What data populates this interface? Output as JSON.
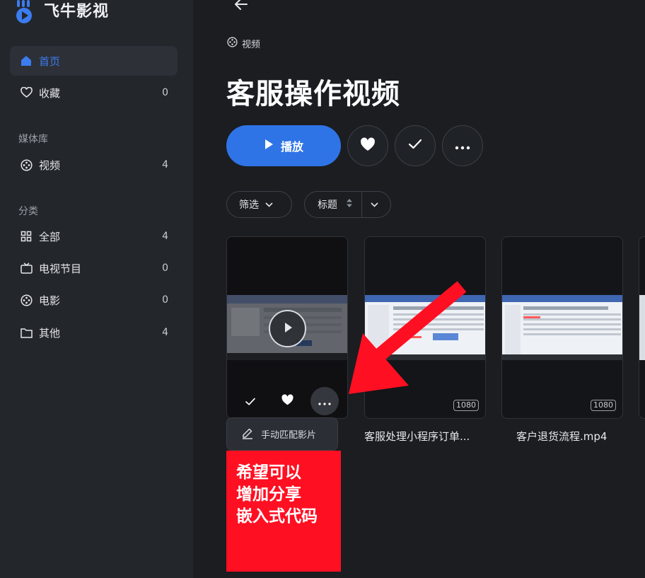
{
  "app": {
    "name": "飞牛影视"
  },
  "sidebar": {
    "nav": [
      {
        "label": "首页",
        "count": "",
        "icon": "home-icon"
      },
      {
        "label": "收藏",
        "count": "0",
        "icon": "heart-icon"
      }
    ],
    "library_title": "媒体库",
    "library": [
      {
        "label": "视频",
        "count": "4",
        "icon": "film-reel-icon"
      }
    ],
    "category_title": "分类",
    "categories": [
      {
        "label": "全部",
        "count": "4",
        "icon": "grid-icon"
      },
      {
        "label": "电视节目",
        "count": "0",
        "icon": "tv-icon"
      },
      {
        "label": "电影",
        "count": "0",
        "icon": "film-reel-icon"
      },
      {
        "label": "其他",
        "count": "4",
        "icon": "folder-icon"
      }
    ]
  },
  "main": {
    "breadcrumb": "视频",
    "title": "客服操作视频",
    "play_label": "播放",
    "filter_label": "筛选",
    "sort_label": "标题",
    "cards": [
      {
        "title": "",
        "badge": ""
      },
      {
        "title": "客服处理小程序订单...",
        "badge": "1080"
      },
      {
        "title": "客户退货流程.mp4",
        "badge": "1080"
      }
    ],
    "context_menu": {
      "match_label": "手动匹配影片"
    },
    "annotation": [
      "希望可以",
      "增加分享",
      "嵌入式代码"
    ]
  },
  "colors": {
    "accent": "#2f74e6",
    "annotation_bg": "#ff0f22",
    "arrow": "#ff0f22"
  }
}
